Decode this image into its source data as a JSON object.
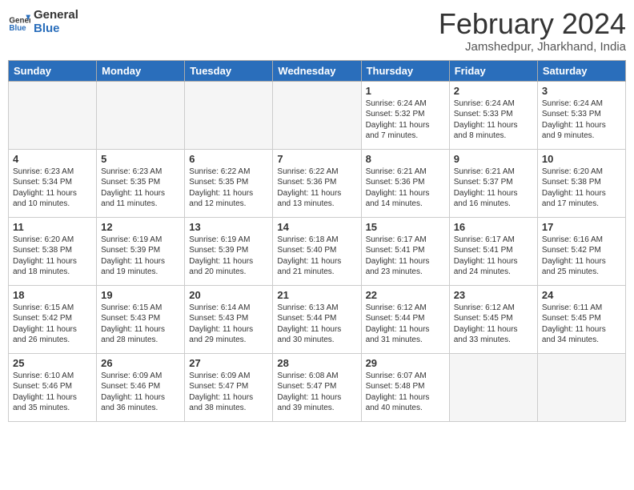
{
  "header": {
    "logo_general": "General",
    "logo_blue": "Blue",
    "month_title": "February 2024",
    "subtitle": "Jamshedpur, Jharkhand, India"
  },
  "days_of_week": [
    "Sunday",
    "Monday",
    "Tuesday",
    "Wednesday",
    "Thursday",
    "Friday",
    "Saturday"
  ],
  "weeks": [
    [
      {
        "day": "",
        "info": "",
        "empty": true
      },
      {
        "day": "",
        "info": "",
        "empty": true
      },
      {
        "day": "",
        "info": "",
        "empty": true
      },
      {
        "day": "",
        "info": "",
        "empty": true
      },
      {
        "day": "1",
        "info": "Sunrise: 6:24 AM\nSunset: 5:32 PM\nDaylight: 11 hours and 7 minutes.",
        "empty": false
      },
      {
        "day": "2",
        "info": "Sunrise: 6:24 AM\nSunset: 5:33 PM\nDaylight: 11 hours and 8 minutes.",
        "empty": false
      },
      {
        "day": "3",
        "info": "Sunrise: 6:24 AM\nSunset: 5:33 PM\nDaylight: 11 hours and 9 minutes.",
        "empty": false
      }
    ],
    [
      {
        "day": "4",
        "info": "Sunrise: 6:23 AM\nSunset: 5:34 PM\nDaylight: 11 hours and 10 minutes.",
        "empty": false
      },
      {
        "day": "5",
        "info": "Sunrise: 6:23 AM\nSunset: 5:35 PM\nDaylight: 11 hours and 11 minutes.",
        "empty": false
      },
      {
        "day": "6",
        "info": "Sunrise: 6:22 AM\nSunset: 5:35 PM\nDaylight: 11 hours and 12 minutes.",
        "empty": false
      },
      {
        "day": "7",
        "info": "Sunrise: 6:22 AM\nSunset: 5:36 PM\nDaylight: 11 hours and 13 minutes.",
        "empty": false
      },
      {
        "day": "8",
        "info": "Sunrise: 6:21 AM\nSunset: 5:36 PM\nDaylight: 11 hours and 14 minutes.",
        "empty": false
      },
      {
        "day": "9",
        "info": "Sunrise: 6:21 AM\nSunset: 5:37 PM\nDaylight: 11 hours and 16 minutes.",
        "empty": false
      },
      {
        "day": "10",
        "info": "Sunrise: 6:20 AM\nSunset: 5:38 PM\nDaylight: 11 hours and 17 minutes.",
        "empty": false
      }
    ],
    [
      {
        "day": "11",
        "info": "Sunrise: 6:20 AM\nSunset: 5:38 PM\nDaylight: 11 hours and 18 minutes.",
        "empty": false
      },
      {
        "day": "12",
        "info": "Sunrise: 6:19 AM\nSunset: 5:39 PM\nDaylight: 11 hours and 19 minutes.",
        "empty": false
      },
      {
        "day": "13",
        "info": "Sunrise: 6:19 AM\nSunset: 5:39 PM\nDaylight: 11 hours and 20 minutes.",
        "empty": false
      },
      {
        "day": "14",
        "info": "Sunrise: 6:18 AM\nSunset: 5:40 PM\nDaylight: 11 hours and 21 minutes.",
        "empty": false
      },
      {
        "day": "15",
        "info": "Sunrise: 6:17 AM\nSunset: 5:41 PM\nDaylight: 11 hours and 23 minutes.",
        "empty": false
      },
      {
        "day": "16",
        "info": "Sunrise: 6:17 AM\nSunset: 5:41 PM\nDaylight: 11 hours and 24 minutes.",
        "empty": false
      },
      {
        "day": "17",
        "info": "Sunrise: 6:16 AM\nSunset: 5:42 PM\nDaylight: 11 hours and 25 minutes.",
        "empty": false
      }
    ],
    [
      {
        "day": "18",
        "info": "Sunrise: 6:15 AM\nSunset: 5:42 PM\nDaylight: 11 hours and 26 minutes.",
        "empty": false
      },
      {
        "day": "19",
        "info": "Sunrise: 6:15 AM\nSunset: 5:43 PM\nDaylight: 11 hours and 28 minutes.",
        "empty": false
      },
      {
        "day": "20",
        "info": "Sunrise: 6:14 AM\nSunset: 5:43 PM\nDaylight: 11 hours and 29 minutes.",
        "empty": false
      },
      {
        "day": "21",
        "info": "Sunrise: 6:13 AM\nSunset: 5:44 PM\nDaylight: 11 hours and 30 minutes.",
        "empty": false
      },
      {
        "day": "22",
        "info": "Sunrise: 6:12 AM\nSunset: 5:44 PM\nDaylight: 11 hours and 31 minutes.",
        "empty": false
      },
      {
        "day": "23",
        "info": "Sunrise: 6:12 AM\nSunset: 5:45 PM\nDaylight: 11 hours and 33 minutes.",
        "empty": false
      },
      {
        "day": "24",
        "info": "Sunrise: 6:11 AM\nSunset: 5:45 PM\nDaylight: 11 hours and 34 minutes.",
        "empty": false
      }
    ],
    [
      {
        "day": "25",
        "info": "Sunrise: 6:10 AM\nSunset: 5:46 PM\nDaylight: 11 hours and 35 minutes.",
        "empty": false
      },
      {
        "day": "26",
        "info": "Sunrise: 6:09 AM\nSunset: 5:46 PM\nDaylight: 11 hours and 36 minutes.",
        "empty": false
      },
      {
        "day": "27",
        "info": "Sunrise: 6:09 AM\nSunset: 5:47 PM\nDaylight: 11 hours and 38 minutes.",
        "empty": false
      },
      {
        "day": "28",
        "info": "Sunrise: 6:08 AM\nSunset: 5:47 PM\nDaylight: 11 hours and 39 minutes.",
        "empty": false
      },
      {
        "day": "29",
        "info": "Sunrise: 6:07 AM\nSunset: 5:48 PM\nDaylight: 11 hours and 40 minutes.",
        "empty": false
      },
      {
        "day": "",
        "info": "",
        "empty": true
      },
      {
        "day": "",
        "info": "",
        "empty": true
      }
    ]
  ]
}
